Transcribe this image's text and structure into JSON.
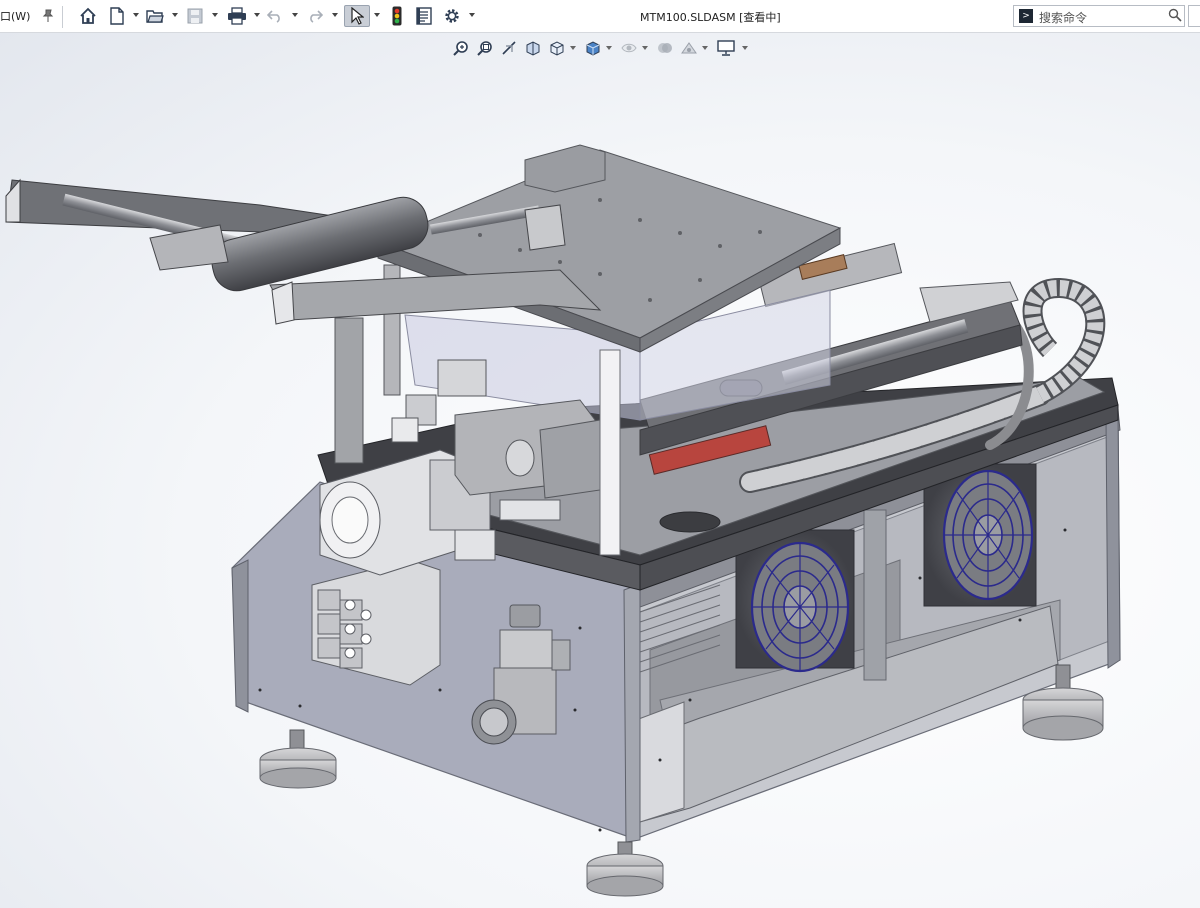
{
  "toolbar": {
    "menu_fragment": "口(W)",
    "icons": [
      "pin-icon",
      "home-icon",
      "new-document-icon",
      "open-icon",
      "save-icon",
      "print-icon",
      "undo-icon",
      "redo-icon",
      "select-cursor-icon",
      "rebuild-traffic-light-icon",
      "file-properties-icon",
      "options-gear-icon"
    ]
  },
  "document": {
    "title": "MTM100.SLDASM [查看中]"
  },
  "search": {
    "placeholder": "搜索命令"
  },
  "heads_up_toolbar": {
    "icons": [
      "zoom-to-fit-icon",
      "zoom-to-area-icon",
      "previous-view-icon",
      "section-view-icon",
      "view-orientation-icon",
      "display-style-icon",
      "hide-show-items-icon",
      "edit-appearance-icon",
      "apply-scene-icon",
      "view-settings-icon"
    ]
  },
  "viewport": {
    "model": "MTM100 assembly"
  },
  "colors": {
    "accent": "#3b4a5e",
    "fan_guard": "#2b2a8c",
    "body_grey": "#9c9ea4",
    "panel_blue_grey": "#a9acbb"
  }
}
